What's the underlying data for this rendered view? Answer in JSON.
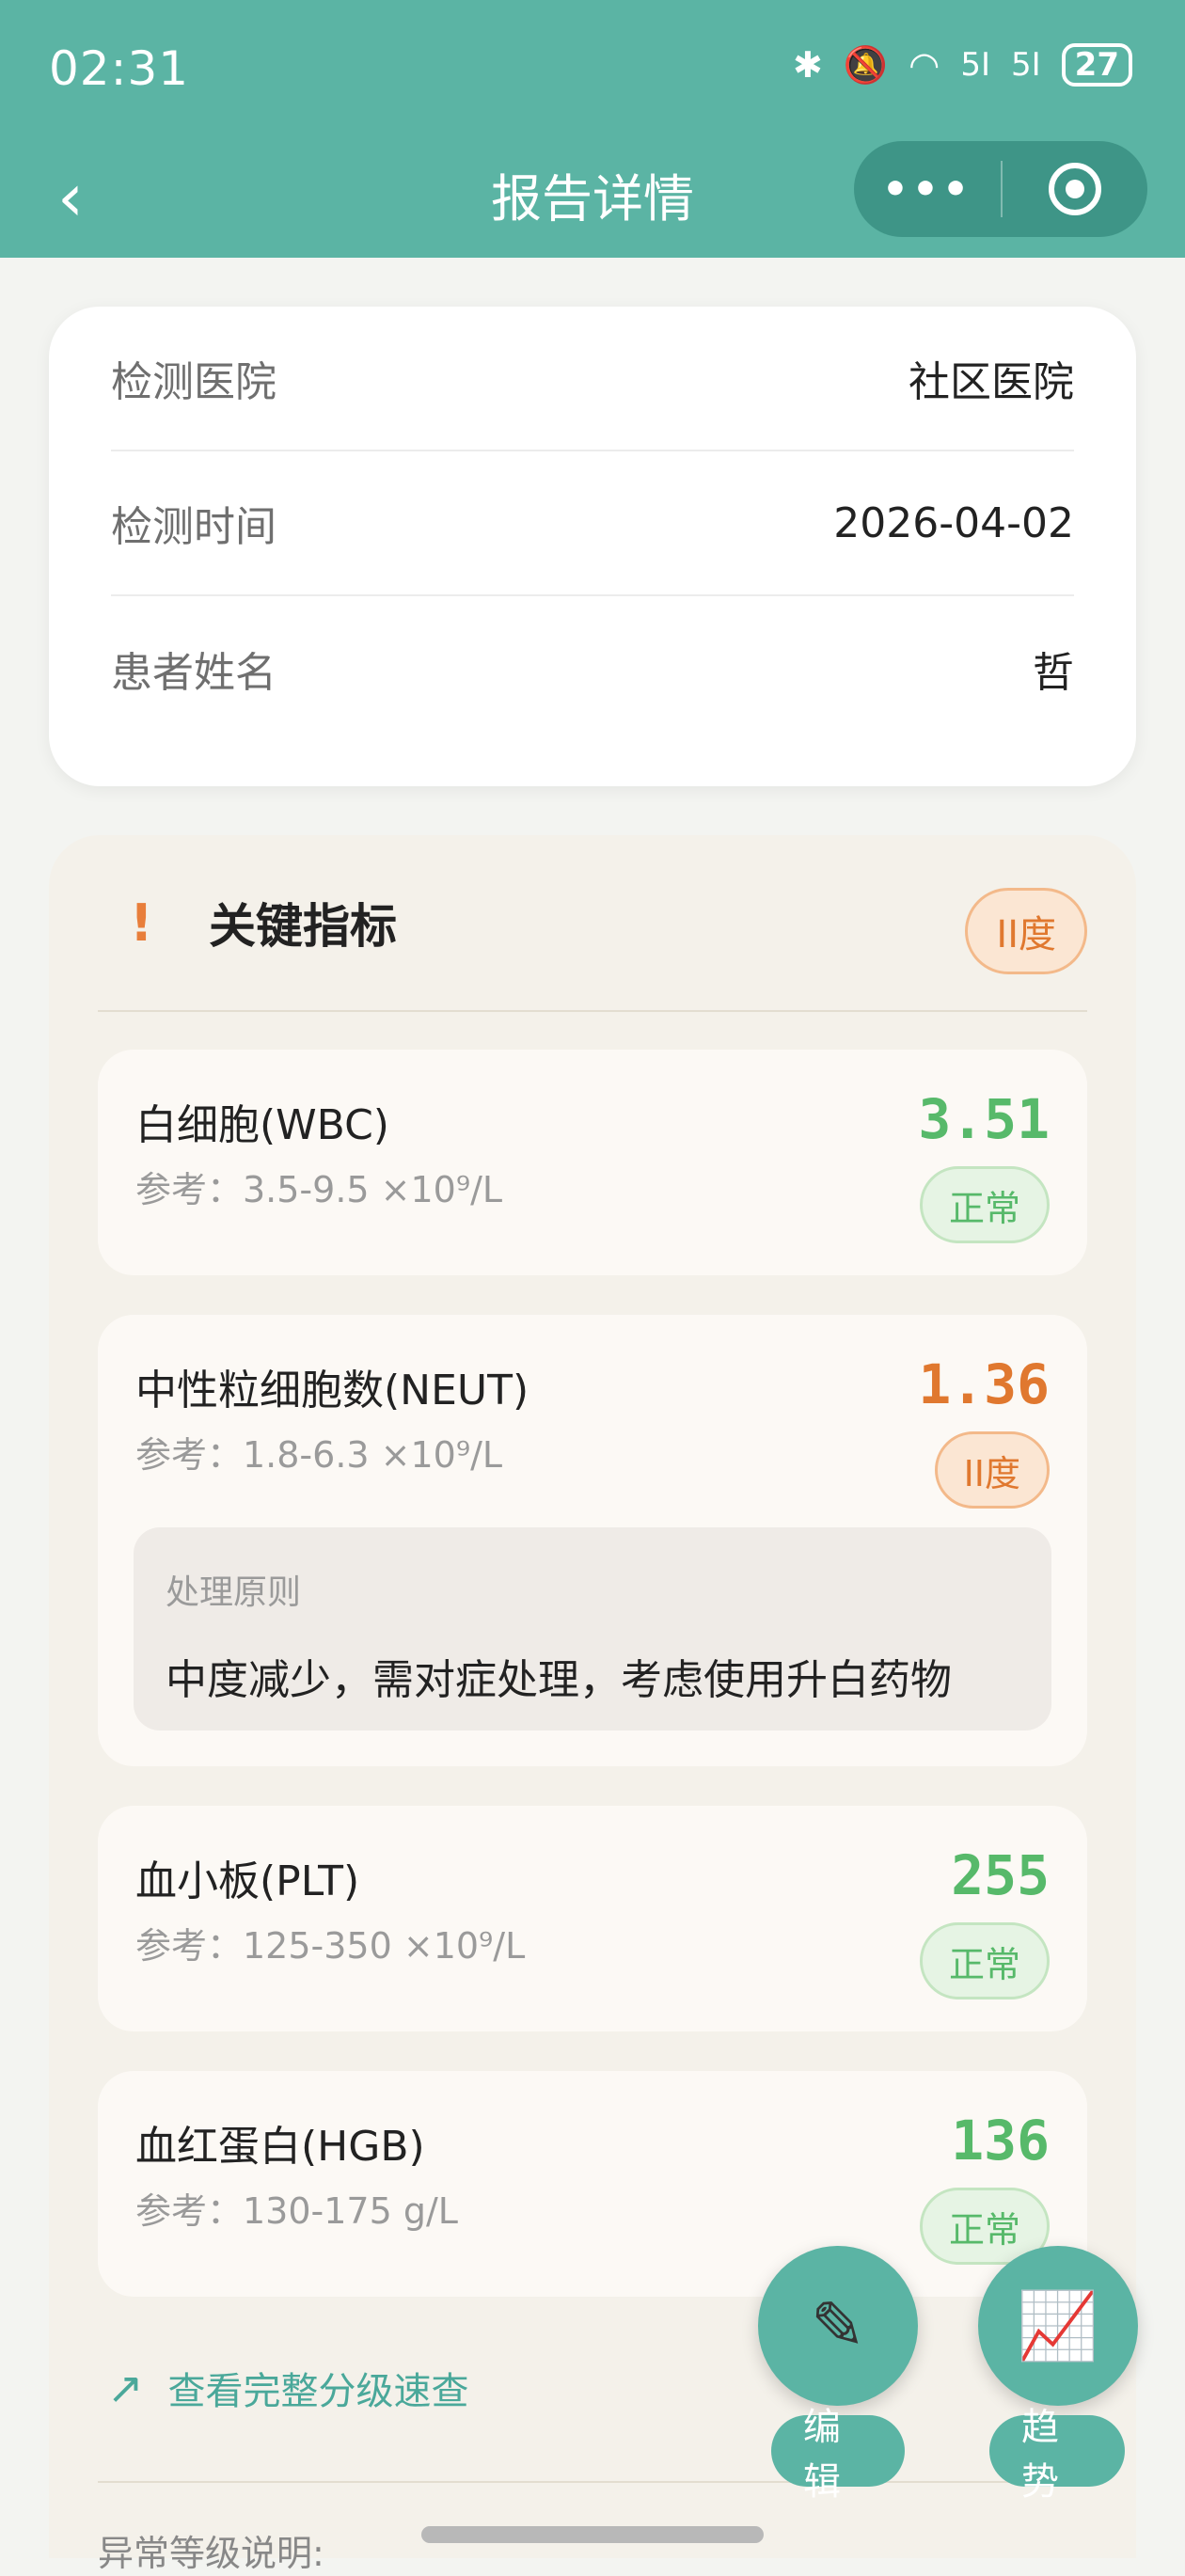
{
  "status_bar": {
    "time": "02:31",
    "signal_1": "5Ⅰ",
    "signal_2": "5Ⅰ",
    "battery": "27"
  },
  "nav": {
    "title": "报告详情",
    "back_icon": "chevron-left-icon",
    "more_icon": "ellipsis-icon",
    "close_icon": "target-icon"
  },
  "info": {
    "rows": [
      {
        "label": "检测医院",
        "value": "社区医院"
      },
      {
        "label": "检测时间",
        "value": "2026-04-02"
      },
      {
        "label": "患者姓名",
        "value": "哲"
      }
    ]
  },
  "key": {
    "icon": "!",
    "title": "关键指标",
    "badge": "II度",
    "indicators": [
      {
        "name": "白细胞(WBC)",
        "ref": "参考：3.5-9.5 ×10⁹/L",
        "value": "3.51",
        "status": "正常"
      },
      {
        "name": "中性粒细胞数(NEUT)",
        "ref": "参考：1.8-6.3 ×10⁹/L",
        "value": "1.36",
        "status": "II度",
        "principle_label": "处理原则",
        "principle_text": "中度减少，需对症处理，考虑使用升白药物"
      },
      {
        "name": "血小板(PLT)",
        "ref": "参考：125-350 ×10⁹/L",
        "value": "255",
        "status": "正常"
      },
      {
        "name": "血红蛋白(HGB)",
        "ref": "参考：130-175 g/L",
        "value": "136",
        "status": "正常"
      }
    ]
  },
  "link": {
    "arrow": "↗",
    "text": "查看完整分级速查"
  },
  "legend": {
    "title": "异常等级说明:"
  },
  "fab": {
    "edit_icon": "✎",
    "edit_label": "编辑",
    "trend_icon": "📈",
    "trend_label": "趋势"
  },
  "colors": {
    "primary": "#5bb4a4",
    "normal": "#57b96a",
    "warning": "#e0782f"
  }
}
